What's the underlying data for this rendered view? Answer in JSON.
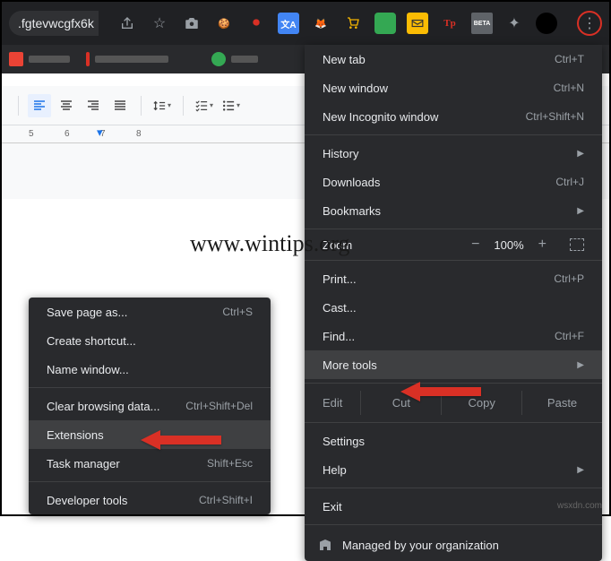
{
  "topbar": {
    "url": ".fgtevwcgfx6k"
  },
  "ext_icons": {
    "tp": "Tp",
    "beta": "BETA"
  },
  "main_menu": {
    "new_tab": "New tab",
    "new_tab_s": "Ctrl+T",
    "new_window": "New window",
    "new_window_s": "Ctrl+N",
    "incognito": "New Incognito window",
    "incognito_s": "Ctrl+Shift+N",
    "history": "History",
    "downloads": "Downloads",
    "downloads_s": "Ctrl+J",
    "bookmarks": "Bookmarks",
    "zoom": "Zoom",
    "zoom_pct": "100%",
    "print": "Print...",
    "print_s": "Ctrl+P",
    "cast": "Cast...",
    "find": "Find...",
    "find_s": "Ctrl+F",
    "more_tools": "More tools",
    "edit": "Edit",
    "cut": "Cut",
    "copy": "Copy",
    "paste": "Paste",
    "settings": "Settings",
    "help": "Help",
    "exit": "Exit",
    "managed": "Managed by your organization"
  },
  "sub_menu": {
    "save_page": "Save page as...",
    "save_page_s": "Ctrl+S",
    "create_shortcut": "Create shortcut...",
    "name_window": "Name window...",
    "clear_data": "Clear browsing data...",
    "clear_data_s": "Ctrl+Shift+Del",
    "extensions": "Extensions",
    "task_mgr": "Task manager",
    "task_mgr_s": "Shift+Esc",
    "dev_tools": "Developer tools",
    "dev_tools_s": "Ctrl+Shift+I"
  },
  "ruler": [
    "5",
    "6",
    "7",
    "8"
  ],
  "watermark": "www.wintips.org",
  "credit": "wsxdn.com"
}
